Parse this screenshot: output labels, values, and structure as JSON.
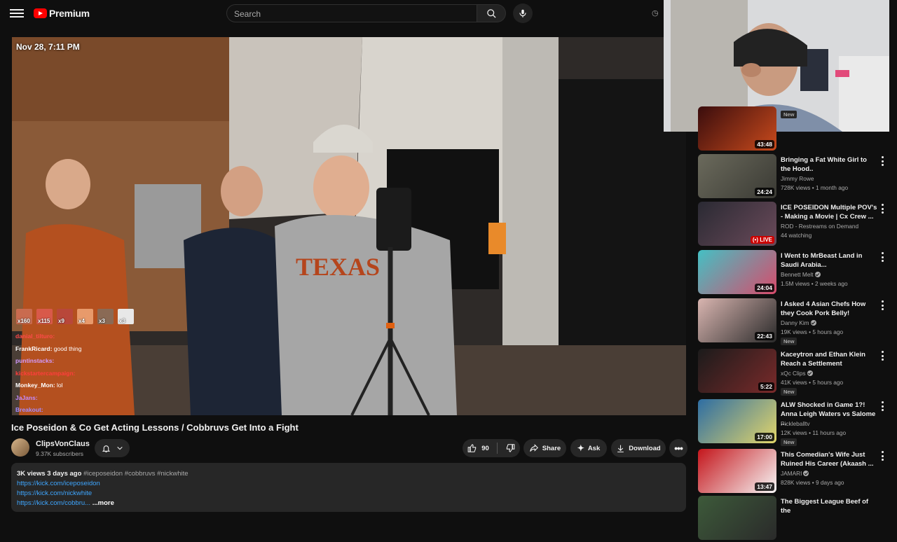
{
  "header": {
    "logo_text": "Premium",
    "search_placeholder": "Search"
  },
  "player": {
    "timestamp": "Nov 28, 7:11 PM",
    "emotes": [
      {
        "count": "x160",
        "color": "#c96b4f"
      },
      {
        "count": "x115",
        "color": "#d8594a"
      },
      {
        "count": "x9",
        "color": "#b8473a"
      },
      {
        "count": "x4",
        "color": "#e89a6b"
      },
      {
        "count": "x3",
        "color": "#8a6a55"
      },
      {
        "count": "x3",
        "color": "#e8e8e8"
      }
    ],
    "chat": [
      {
        "user": "danial_tilturo",
        "text": "",
        "color": "#ff4a4a"
      },
      {
        "user": "FrankRicard",
        "text": "good thing",
        "color": "#ffffff"
      },
      {
        "user": "puntinstacks",
        "text": "",
        "color": "#d29bff"
      },
      {
        "user": "kickstartercampaign",
        "text": "",
        "color": "#ff3d3d"
      },
      {
        "user": "Monkey_Mon",
        "text": "lol",
        "color": "#ffffff"
      },
      {
        "user": "JaJans",
        "text": "",
        "color": "#c38bff"
      },
      {
        "user": "Breakout",
        "text": "",
        "color": "#a58bff"
      }
    ]
  },
  "video": {
    "title": "Ice Poseidon & Co Get Acting Lessons / Cobbruvs Get Into a Fight",
    "channel": "ClipsVonClaus",
    "subscribers": "9.37K subscribers",
    "likes": "90",
    "share_label": "Share",
    "ask_label": "Ask",
    "download_label": "Download"
  },
  "description": {
    "stats": "3K views  3 days ago",
    "tags": "#iceposeidon #cobbruvs #nickwhite",
    "links": [
      "https://kick.com/iceposeidon",
      "https://kick.com/nickwhite",
      "https://kick.com/cobbru..."
    ],
    "more": "...more"
  },
  "recommendations": [
    {
      "title": "",
      "channel": "",
      "meta": "",
      "duration": "43:48",
      "badge": "New",
      "live": false,
      "verified": false
    },
    {
      "title": "Bringing a Fat White Girl to the Hood..",
      "channel": "Jimmy Rowe",
      "meta": "728K views • 1 month ago",
      "duration": "24:24",
      "badge": "",
      "live": false,
      "verified": false
    },
    {
      "title": "ICE POSEIDON Multiple POV's - Making a Movie | Cx Crew ...",
      "channel": "ROD - Restreams on Demand",
      "meta": "44 watching",
      "duration": "LIVE",
      "badge": "",
      "live": true,
      "verified": false
    },
    {
      "title": "I Went to MrBeast Land in Saudi Arabia...",
      "channel": "Bennett Melt",
      "meta": "1.5M views • 2 weeks ago",
      "duration": "24:04",
      "badge": "",
      "live": false,
      "verified": true
    },
    {
      "title": "I Asked 4 Asian Chefs How they Cook Pork Belly!",
      "channel": "Danny Kim",
      "meta": "19K views • 5 hours ago",
      "duration": "22:43",
      "badge": "New",
      "live": false,
      "verified": true
    },
    {
      "title": "Kaceytron and Ethan Klein Reach a Settlement",
      "channel": "xQc Clips",
      "meta": "41K views • 5 hours ago",
      "duration": "5:22",
      "badge": "New",
      "live": false,
      "verified": true
    },
    {
      "title": "ALW Shocked in Game 1?! Anna Leigh Waters vs Salome ...",
      "channel": "Pickleballtv",
      "meta": "12K views • 11 hours ago",
      "duration": "17:00",
      "badge": "New",
      "live": false,
      "verified": false
    },
    {
      "title": "This Comedian's Wife Just Ruined His Career (Akaash ...",
      "channel": "JAMARI",
      "meta": "828K views • 9 days ago",
      "duration": "13:47",
      "badge": "",
      "live": false,
      "verified": true
    },
    {
      "title": "The Biggest League Beef of the",
      "channel": "",
      "meta": "",
      "duration": "",
      "badge": "",
      "live": false,
      "verified": false
    }
  ]
}
